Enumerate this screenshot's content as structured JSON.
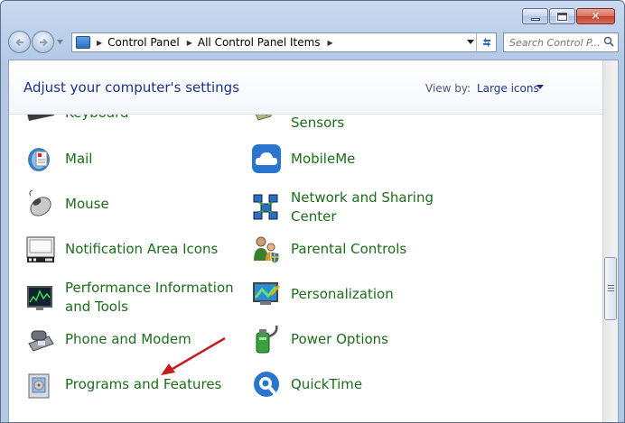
{
  "window": {
    "caption": {
      "minimize_icon": "minimize-icon",
      "maximize_icon": "maximize-icon",
      "close_icon": "close-icon",
      "close_glyph": "✕"
    }
  },
  "nav": {
    "back_icon": "back-arrow-icon",
    "forward_icon": "forward-arrow-icon"
  },
  "address": {
    "crumbs": [
      "Control Panel",
      "All Control Panel Items"
    ],
    "separator": "▶"
  },
  "search": {
    "placeholder": "Search Control P..."
  },
  "header": {
    "title": "Adjust your computer's settings",
    "view_by_label": "View by:",
    "view_by_value": "Large icons"
  },
  "items": {
    "left": [
      {
        "label": "Keyboard",
        "icon": "keyboard-icon"
      },
      {
        "label": "Mail",
        "icon": "mail-icon"
      },
      {
        "label": "Mouse",
        "icon": "mouse-icon"
      },
      {
        "label": "Notification Area Icons",
        "icon": "notification-icon"
      },
      {
        "label": "Performance Information and Tools",
        "icon": "performance-icon"
      },
      {
        "label": "Phone and Modem",
        "icon": "phone-icon"
      },
      {
        "label": "Programs and Features",
        "icon": "programs-icon"
      }
    ],
    "right": [
      {
        "label": "Sensors",
        "icon": "sensors-icon"
      },
      {
        "label": "MobileMe",
        "icon": "cloud-icon"
      },
      {
        "label": "Network and Sharing Center",
        "icon": "network-icon"
      },
      {
        "label": "Parental Controls",
        "icon": "parental-controls-icon"
      },
      {
        "label": "Personalization",
        "icon": "personalization-icon"
      },
      {
        "label": "Power Options",
        "icon": "power-icon"
      },
      {
        "label": "QuickTime",
        "icon": "quicktime-icon"
      }
    ]
  },
  "colors": {
    "link_green": "#1b6d1b",
    "title_blue": "#1e3287",
    "arrow_red": "#c41e1e"
  }
}
